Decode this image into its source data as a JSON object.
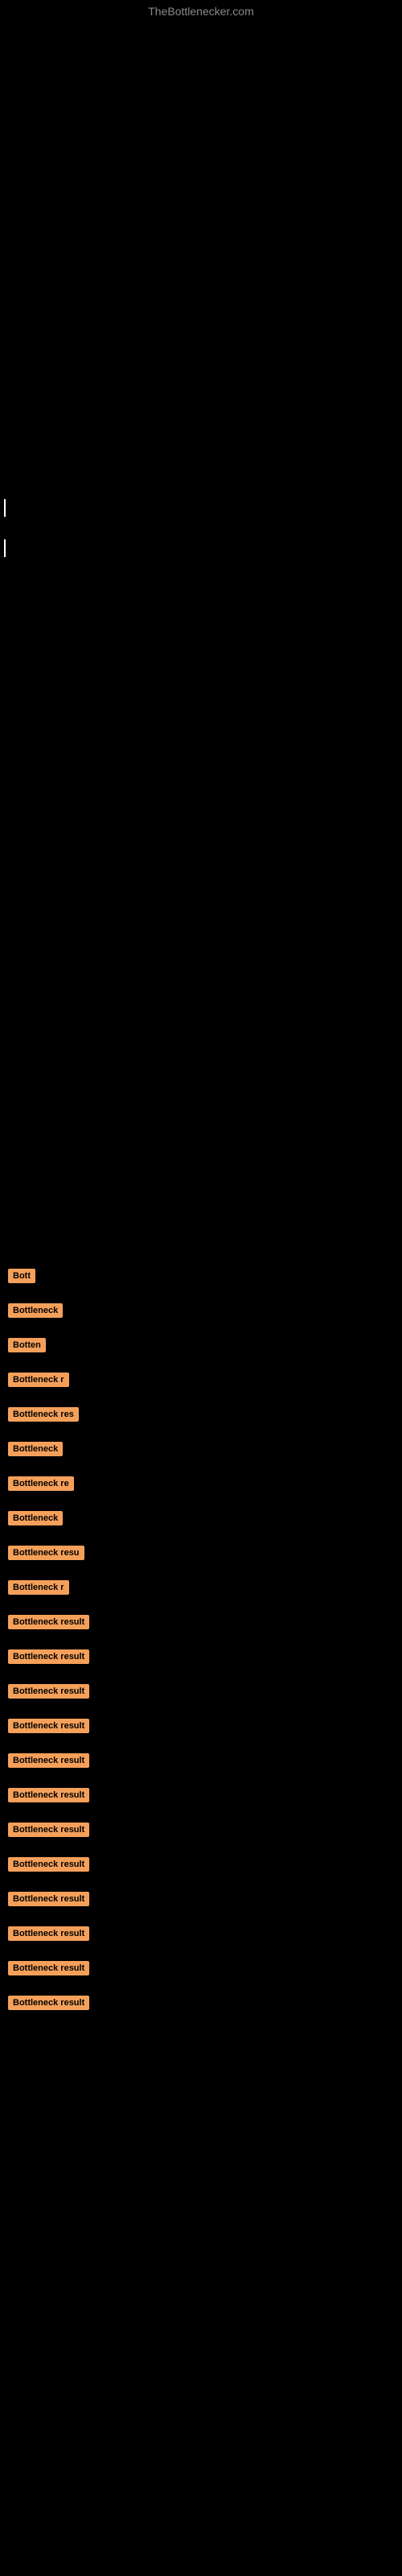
{
  "site": {
    "title": "TheBottlenecker.com"
  },
  "results": [
    {
      "id": 1,
      "label": "Bott",
      "width_class": "badge-w1"
    },
    {
      "id": 2,
      "label": "Bottleneck",
      "width_class": "badge-w2"
    },
    {
      "id": 3,
      "label": "Botten",
      "width_class": "badge-w3"
    },
    {
      "id": 4,
      "label": "Bottleneck r",
      "width_class": "badge-w4"
    },
    {
      "id": 5,
      "label": "Bottleneck res",
      "width_class": "badge-w5"
    },
    {
      "id": 6,
      "label": "Bottleneck",
      "width_class": "badge-w6"
    },
    {
      "id": 7,
      "label": "Bottleneck re",
      "width_class": "badge-w7"
    },
    {
      "id": 8,
      "label": "Bottleneck",
      "width_class": "badge-w8"
    },
    {
      "id": 9,
      "label": "Bottleneck resu",
      "width_class": "badge-w9"
    },
    {
      "id": 10,
      "label": "Bottleneck r",
      "width_class": "badge-w10"
    },
    {
      "id": 11,
      "label": "Bottleneck result",
      "width_class": "badge-w11"
    },
    {
      "id": 12,
      "label": "Bottleneck result",
      "width_class": "badge-w12"
    },
    {
      "id": 13,
      "label": "Bottleneck result",
      "width_class": "badge-w13"
    },
    {
      "id": 14,
      "label": "Bottleneck result",
      "width_class": "badge-w14"
    },
    {
      "id": 15,
      "label": "Bottleneck result",
      "width_class": "badge-w15"
    },
    {
      "id": 16,
      "label": "Bottleneck result",
      "width_class": "badge-w16"
    },
    {
      "id": 17,
      "label": "Bottleneck result",
      "width_class": "badge-w17"
    },
    {
      "id": 18,
      "label": "Bottleneck result",
      "width_class": "badge-w18"
    },
    {
      "id": 19,
      "label": "Bottleneck result",
      "width_class": "badge-w19"
    },
    {
      "id": 20,
      "label": "Bottleneck result",
      "width_class": "badge-w20"
    },
    {
      "id": 21,
      "label": "Bottleneck result",
      "width_class": "badge-w21"
    },
    {
      "id": 22,
      "label": "Bottleneck result",
      "width_class": "badge-w22"
    }
  ]
}
